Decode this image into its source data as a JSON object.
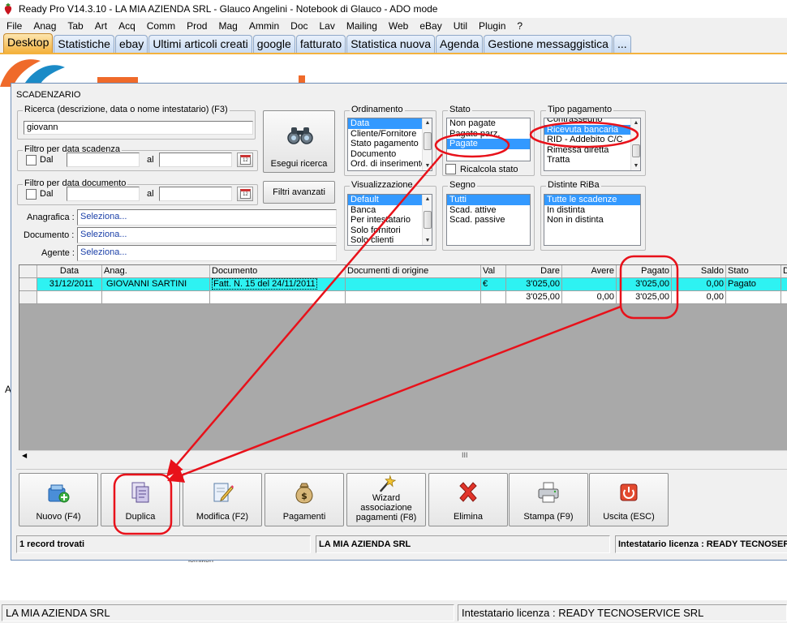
{
  "window_title": "Ready Pro V14.3.10 - LA MIA AZIENDA SRL - Glauco Angelini - Notebook di Glauco - ADO mode",
  "menu": [
    "File",
    "Anag",
    "Tab",
    "Art",
    "Acq",
    "Comm",
    "Prod",
    "Mag",
    "Ammin",
    "Doc",
    "Lav",
    "Mailing",
    "Web",
    "eBay",
    "Util",
    "Plugin",
    "?"
  ],
  "tabs": [
    "Desktop",
    "Statistiche",
    "ebay",
    "Ultimi articoli creati",
    "google",
    "fatturato",
    "Statistica nuova",
    "Agenda",
    "Gestione messaggistica",
    "..."
  ],
  "desktop": {
    "stray_label_1": "A",
    "stray_label_2": "lomikon"
  },
  "scad": {
    "title": "SCADENZARIO",
    "search": {
      "legend": "Ricerca (descrizione, data o nome intestatario) (F3)",
      "value": "giovann"
    },
    "scadenza": {
      "legend": "Filtro per data scadenza",
      "dal": "Dal",
      "al": "al"
    },
    "documento": {
      "legend": "Filtro per data documento",
      "dal": "Dal",
      "al": "al"
    },
    "btn_search": "Esegui ricerca",
    "btn_filters": "Filtri avanzati",
    "anagrafica_label": "Anagrafica :",
    "documento_label": "Documento :",
    "agente_label": "Agente :",
    "seleziona": "Seleziona...",
    "ordinamento": {
      "legend": "Ordinamento",
      "items": [
        "Data",
        "Cliente/Fornitore",
        "Stato pagamento",
        "Documento",
        "Ord. di inserimento"
      ],
      "selected": 0
    },
    "stato": {
      "legend": "Stato",
      "items": [
        "Non pagate",
        "Pagate parz.",
        "Pagate"
      ],
      "selected": 2,
      "ricalcola": "Ricalcola stato"
    },
    "tipo": {
      "legend": "Tipo pagamento",
      "items": [
        "Contrassegno",
        "Ricevuta bancaria",
        "RID - Addebito C/C",
        "Rimessa diretta",
        "Tratta"
      ],
      "selected": 1
    },
    "visualizzazione": {
      "legend": "Visualizzazione",
      "items": [
        "Default",
        "Banca",
        "Per intestatario",
        "Solo fornitori",
        "Solo clienti"
      ],
      "selected": 0
    },
    "segno": {
      "legend": "Segno",
      "items": [
        "Tutti",
        "Scad. attive",
        "Scad. passive"
      ],
      "selected": 0
    },
    "distinte": {
      "legend": "Distinte RiBa",
      "items": [
        "Tutte le scadenze",
        "In distinta",
        "Non in distinta"
      ],
      "selected": 0
    },
    "columns": [
      "Data",
      "Anag.",
      "Documento",
      "Documenti di origine",
      "Val",
      "Dare",
      "Avere",
      "Pagato",
      "Saldo",
      "Stato",
      "D"
    ],
    "rows": [
      {
        "data": "31/12/2011",
        "anag": "GIOVANNI SARTINI",
        "documento": "Fatt. N. 15 del 24/11/2011",
        "origine": "",
        "val": "€",
        "dare": "3'025,00",
        "avere": "",
        "pagato": "3'025,00",
        "saldo": "0,00",
        "stato": "Pagato"
      }
    ],
    "totals": {
      "dare": "3'025,00",
      "avere": "0,00",
      "pagato": "3'025,00",
      "saldo": "0,00"
    },
    "scroll_mark": "III",
    "toolbar": [
      {
        "label": "Nuovo (F4)",
        "icon": "new-icon"
      },
      {
        "label": "Duplica",
        "icon": "duplicate-icon"
      },
      {
        "label": "Modifica (F2)",
        "icon": "edit-icon"
      },
      {
        "label": "Pagamenti",
        "icon": "money-bag-icon"
      },
      {
        "label": "Wizard\nassociazione\npagamenti (F8)",
        "icon": "wizard-icon"
      },
      {
        "label": "Elimina",
        "icon": "delete-icon"
      },
      {
        "label": "Stampa (F9)",
        "icon": "printer-icon"
      },
      {
        "label": "Uscita (ESC)",
        "icon": "exit-icon"
      }
    ],
    "status": {
      "records": "1 record trovati",
      "company": "LA MIA AZIENDA SRL",
      "license": "Intestatario licenza : READY TECNOSERVICE SRL"
    }
  },
  "app_status": {
    "company": "LA MIA AZIENDA SRL",
    "license": "Intestatario licenza : READY TECNOSERVICE SRL"
  },
  "colors": {
    "highlight": "#3399ff",
    "row_selected": "#2ef2f2",
    "annotation": "#e8111a",
    "tab_active": "#f4b23e"
  }
}
